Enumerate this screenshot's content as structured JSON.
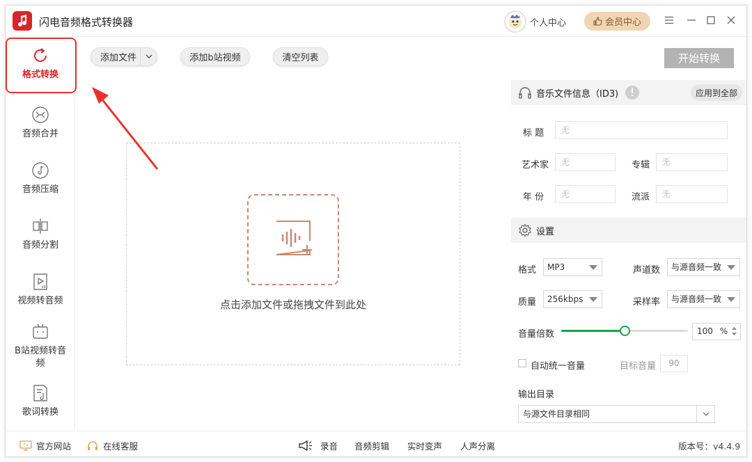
{
  "app": {
    "title": "闪电音频格式转换器",
    "user_center": "个人中心",
    "vip_center": "会员中心",
    "version": "版本号：v4.4.9"
  },
  "sidebar": {
    "items": [
      {
        "label": "格式转换",
        "icon": "refresh-icon"
      },
      {
        "label": "音频合并",
        "icon": "merge-icon"
      },
      {
        "label": "音频压缩",
        "icon": "compress-icon"
      },
      {
        "label": "音频分割",
        "icon": "split-icon"
      },
      {
        "label": "视频转音频",
        "icon": "video-audio-icon"
      },
      {
        "label": "B站视频转音频",
        "icon": "bilibili-icon"
      },
      {
        "label": "歌词转换",
        "icon": "lyrics-icon"
      }
    ]
  },
  "toolbar": {
    "add_file": "添加文件",
    "add_bilibili": "添加b站视频",
    "clear_list": "清空列表",
    "start": "开始转换"
  },
  "dropzone": {
    "text": "点击添加文件或拖拽文件到此处"
  },
  "id3": {
    "header": "音乐文件信息（ID3)",
    "apply_all": "应用到全部",
    "title_label": "标  题",
    "artist_label": "艺术家",
    "album_label": "专辑",
    "year_label": "年  份",
    "genre_label": "流派",
    "placeholder": "无"
  },
  "settings": {
    "header": "设置",
    "format_label": "格式",
    "format_value": "MP3",
    "channels_label": "声道数",
    "channels_value": "与源音频一致",
    "quality_label": "质量",
    "quality_value": "256kbps",
    "samplerate_label": "采样率",
    "samplerate_value": "与源音频一致",
    "volume_label": "音量倍数",
    "volume_value": "100",
    "volume_unit": "%",
    "volume_fraction": 0.5,
    "auto_volume_label": "自动统一音量",
    "target_volume_label": "目标音量",
    "target_volume_value": "90",
    "output_label": "输出目录",
    "output_value": "与源文件目录相同"
  },
  "footer": {
    "website": "官方网站",
    "support": "在线客服",
    "record": "录音",
    "edit": "音频剪辑",
    "voice_change": "实时变声",
    "vocal_split": "人声分离"
  },
  "colors": {
    "brand_red": "#d9252a",
    "accent_green": "#1aa34a",
    "vip_gold": "#f0d5b3",
    "drop_border": "#c78a6d"
  }
}
